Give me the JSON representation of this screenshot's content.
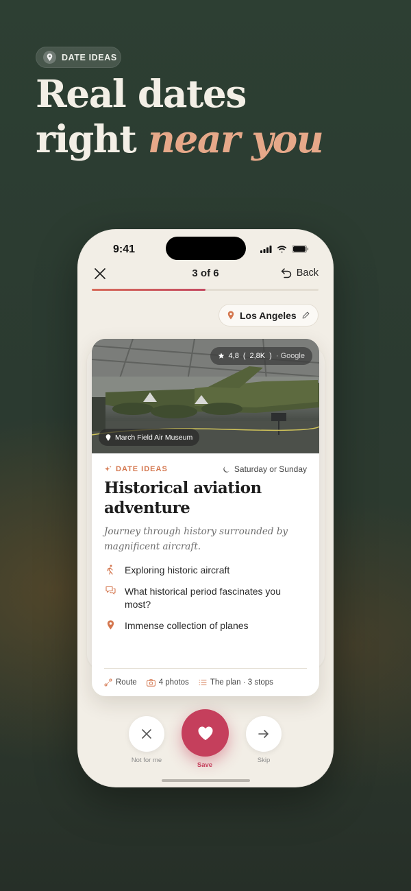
{
  "promo": {
    "pill_label": "DATE IDEAS",
    "headline_line1": "Real dates",
    "headline_line2_plain": "right ",
    "headline_line2_accent": "near you"
  },
  "status_bar": {
    "time": "9:41"
  },
  "nav": {
    "title": "3 of 6",
    "back_label": "Back",
    "progress": 0.5
  },
  "location": {
    "city": "Los Angeles"
  },
  "card": {
    "rating": "4,8",
    "reviews": "2,8K",
    "source": "· Google",
    "place": "March Field Air Museum",
    "tag": "DATE IDEAS",
    "when": "Saturday or Sunday",
    "title_line1": "Historical aviation",
    "title_line2": "adventure",
    "subtitle_line1": "Journey through history surrounded by",
    "subtitle_line2": "magnificent aircraft.",
    "points": [
      {
        "icon": "walking-icon",
        "text": "Exploring historic aircraft"
      },
      {
        "icon": "chat-icon",
        "text": "What historical period fascinates you most?"
      },
      {
        "icon": "pin-icon",
        "text": "Immense collection of planes"
      }
    ],
    "footer": {
      "route": "Route",
      "photos": "4 photos",
      "plan": "The plan · 3 stops"
    }
  },
  "actions": {
    "skip_left_label": "Not for me",
    "save_label": "Save",
    "skip_label": "Skip"
  },
  "colors": {
    "accent": "#c53f5c",
    "tag": "#d4774f",
    "headline_accent": "#e6a889",
    "background": "#2c3a30"
  }
}
